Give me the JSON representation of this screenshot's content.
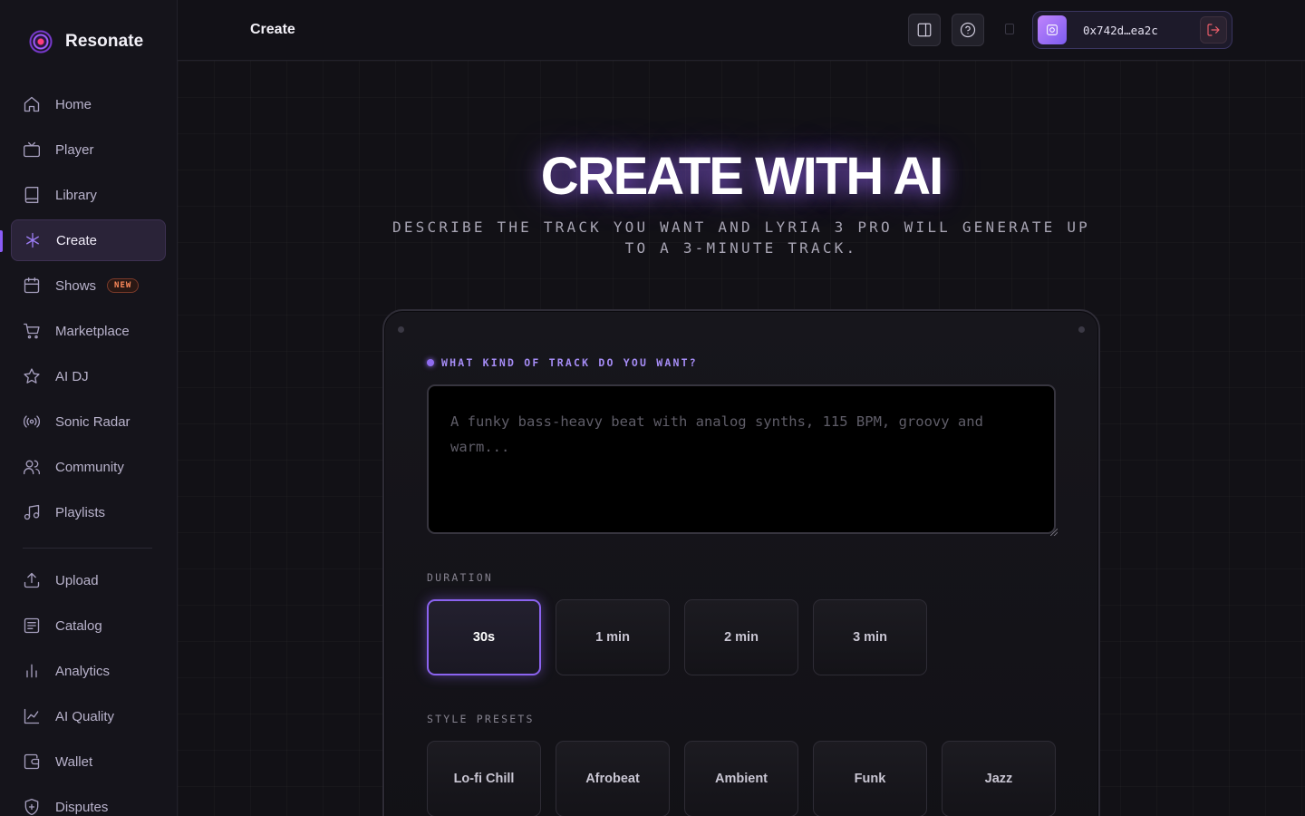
{
  "brand": {
    "name": "Resonate"
  },
  "nav": {
    "items": [
      {
        "label": "Home",
        "icon": "home-icon"
      },
      {
        "label": "Player",
        "icon": "tv-icon"
      },
      {
        "label": "Library",
        "icon": "book-icon"
      },
      {
        "label": "Create",
        "icon": "sparkle-icon",
        "active": true
      },
      {
        "label": "Shows",
        "icon": "calendar-icon",
        "badge": "NEW"
      },
      {
        "label": "Marketplace",
        "icon": "cart-icon"
      },
      {
        "label": "AI DJ",
        "icon": "star-icon"
      },
      {
        "label": "Sonic Radar",
        "icon": "radar-icon"
      },
      {
        "label": "Community",
        "icon": "users-icon"
      },
      {
        "label": "Playlists",
        "icon": "music-icon"
      }
    ],
    "secondary": [
      {
        "label": "Upload",
        "icon": "upload-icon"
      },
      {
        "label": "Catalog",
        "icon": "list-icon"
      },
      {
        "label": "Analytics",
        "icon": "bar-chart-icon"
      },
      {
        "label": "AI Quality",
        "icon": "line-chart-icon"
      },
      {
        "label": "Wallet",
        "icon": "wallet-icon"
      },
      {
        "label": "Disputes",
        "icon": "shield-icon"
      }
    ]
  },
  "header": {
    "title": "Create",
    "wallet_address": "0x742d…ea2c"
  },
  "hero": {
    "title": "CREATE WITH AI",
    "subtitle": "DESCRIBE THE TRACK YOU WANT AND LYRIA 3 PRO WILL GENERATE UP TO A 3-MINUTE TRACK."
  },
  "form": {
    "prompt_label": "WHAT KIND OF TRACK DO YOU WANT?",
    "prompt_placeholder": "A funky bass-heavy beat with analog synths, 115 BPM, groovy and warm...",
    "prompt_value": "",
    "duration_label": "DURATION",
    "durations": [
      "30s",
      "1 min",
      "2 min",
      "3 min"
    ],
    "duration_selected": "30s",
    "style_label": "STYLE PRESETS",
    "styles": [
      "Lo-fi Chill",
      "Afrobeat",
      "Ambient",
      "Funk",
      "Jazz"
    ]
  },
  "colors": {
    "accent": "#8b5cf6",
    "background": "#121116",
    "sidebar": "#15141b",
    "danger": "#ef5f6b",
    "badge": "#ff8a5b"
  }
}
